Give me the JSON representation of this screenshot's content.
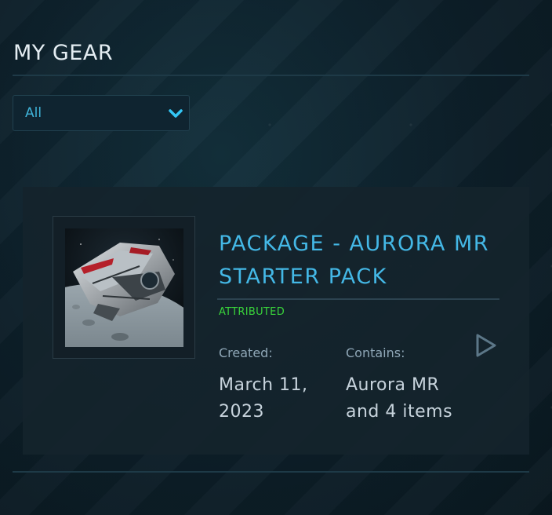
{
  "page": {
    "title": "MY GEAR"
  },
  "filter": {
    "selected": "All",
    "icon": "chevron-down-icon",
    "accent": "#3fb3d8"
  },
  "package": {
    "title": "PACKAGE - AURORA MR STARTER PACK",
    "status": "ATTRIBUTED",
    "status_color": "#39d43b",
    "title_color": "#44b8e6",
    "created_label": "Created:",
    "created_value": "March 11, 2023",
    "contains_label": "Contains:",
    "contains_value": "Aurora MR and 4 items",
    "thumbnail": "ship-image",
    "action_icon": "play-icon"
  }
}
